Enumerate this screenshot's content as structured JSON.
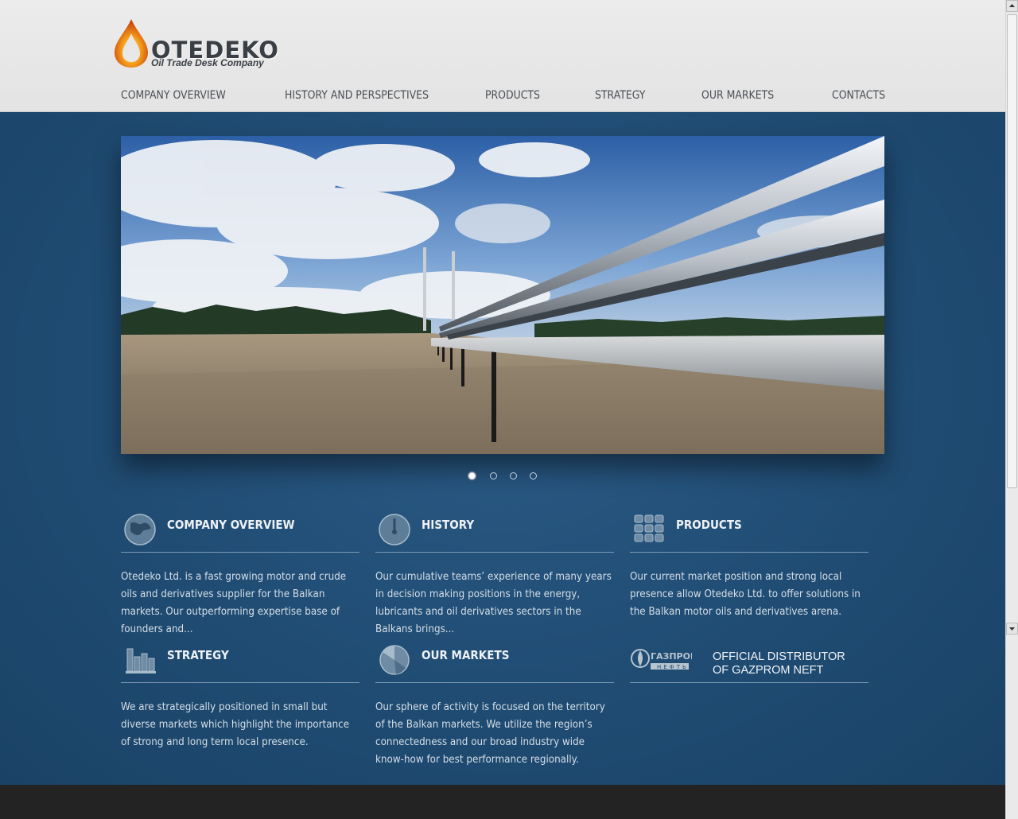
{
  "logo": {
    "name": "OTEDEKO",
    "tagline": "Oil Trade Desk Company"
  },
  "nav": [
    {
      "label": "COMPANY OVERVIEW"
    },
    {
      "label": "HISTORY AND PERSPECTIVES"
    },
    {
      "label": "PRODUCTS"
    },
    {
      "label": "STRATEGY"
    },
    {
      "label": "OUR MARKETS"
    },
    {
      "label": "CONTACTS"
    }
  ],
  "slider": {
    "slide_count": 4,
    "active_slide": 1,
    "image": "pipeline-landscape"
  },
  "features": [
    {
      "title": "COMPANY OVERVIEW",
      "icon": "globe-icon",
      "text": "Otedeko Ltd. is a fast growing motor and crude oils and derivatives supplier for the Balkan markets. Our outperforming expertise base of founders and..."
    },
    {
      "title": "HISTORY",
      "icon": "clock-icon",
      "text": "Our cumulative teams’ experience of many years in decision making positions in the energy, lubricants and oil derivatives sectors in the Balkans brings..."
    },
    {
      "title": "PRODUCTS",
      "icon": "grid-icon",
      "text": "Our current market position and strong local presence allow Otedeko Ltd. to offer solutions in the Balkan motor oils and derivatives arena."
    },
    {
      "title": "STRATEGY",
      "icon": "bar-chart-icon",
      "text": "We are strategically positioned in small but diverse markets which highlight the importance of strong and long term local presence."
    },
    {
      "title": "OUR MARKETS",
      "icon": "pie-chart-icon",
      "text": "Our sphere of activity is focused on the territory of the Balkan markets. We utilize the region’s connectedness and our broad industry wide know-how for best performance regionally."
    }
  ],
  "partner": {
    "logo_text": "ГАЗПРОМ",
    "logo_sub": "НЕФТЬ",
    "line1": "OFFICIAL DISTRIBUTOR",
    "line2": "OF GAZPROM NEFT"
  },
  "colors": {
    "accent_bg": "#1e4a70",
    "header_bg": "#e8e8e8",
    "footer_bg": "#232323"
  }
}
